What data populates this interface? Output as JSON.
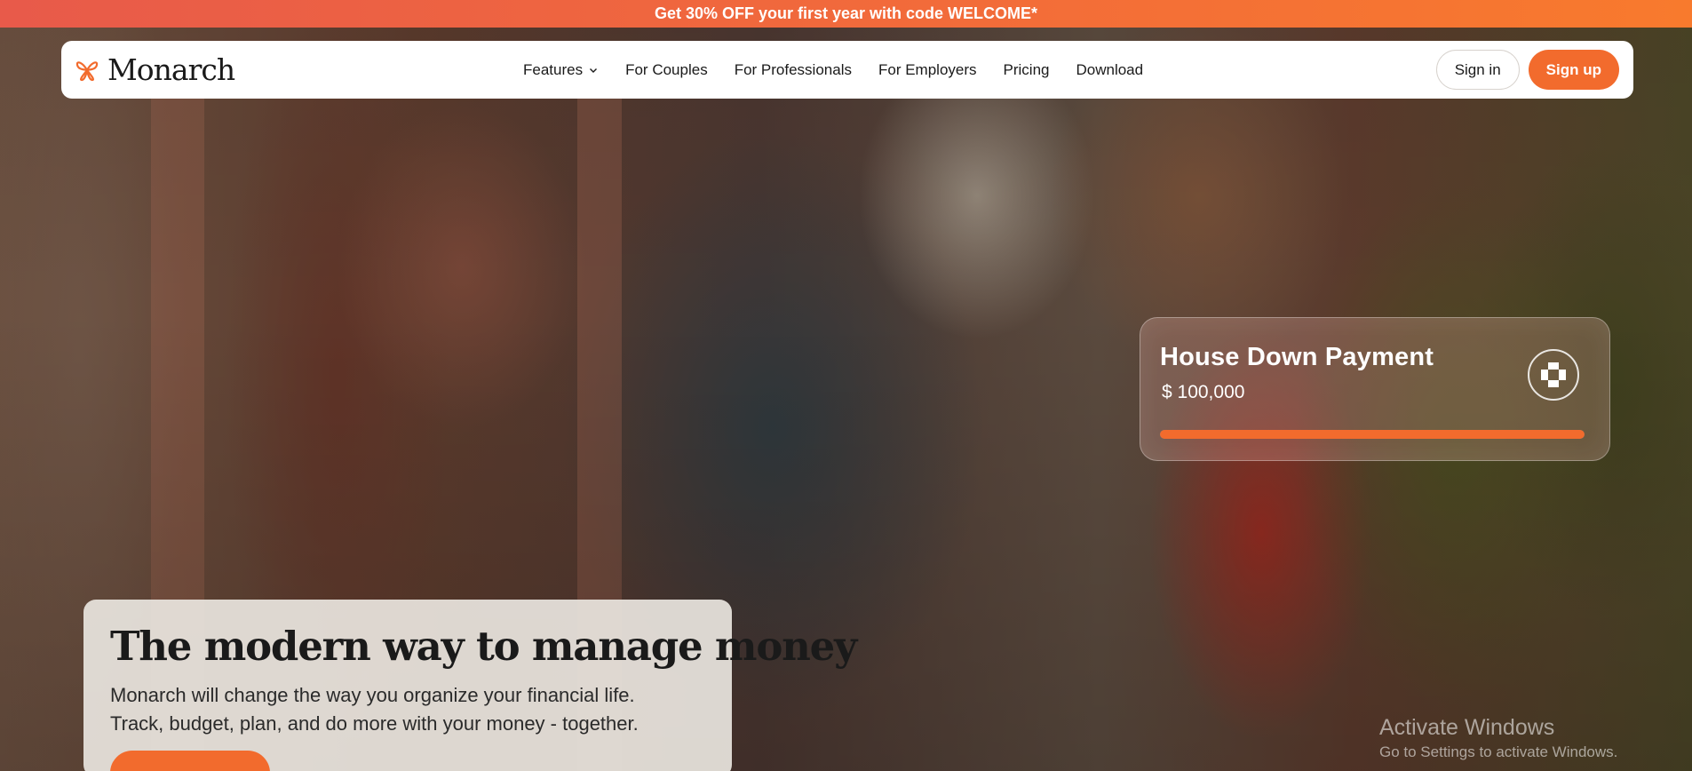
{
  "promo": {
    "text": "Get 30% OFF your first year with code WELCOME*"
  },
  "nav": {
    "brand": "Monarch",
    "links": [
      {
        "label": "Features",
        "has_dropdown": true
      },
      {
        "label": "For Couples"
      },
      {
        "label": "For Professionals"
      },
      {
        "label": "For Employers"
      },
      {
        "label": "Pricing"
      },
      {
        "label": "Download"
      }
    ],
    "sign_in": "Sign in",
    "sign_up": "Sign up"
  },
  "goal_card": {
    "title": "House Down Payment",
    "amount": "$ 100,000",
    "progress": 1.0,
    "icon": "chase-bank-logo-icon"
  },
  "hero": {
    "title": "The modern way to manage money",
    "subtitle_line1": "Monarch will change the way you organize your financial life.",
    "subtitle_line2": "Track, budget, plan, and do more with your money - together."
  },
  "watermark": {
    "title": "Activate Windows",
    "subtitle": "Go to Settings to activate Windows."
  },
  "colors": {
    "accent": "#f26b2d",
    "promo_start": "#e85a4a",
    "promo_end": "#f87a2d"
  }
}
